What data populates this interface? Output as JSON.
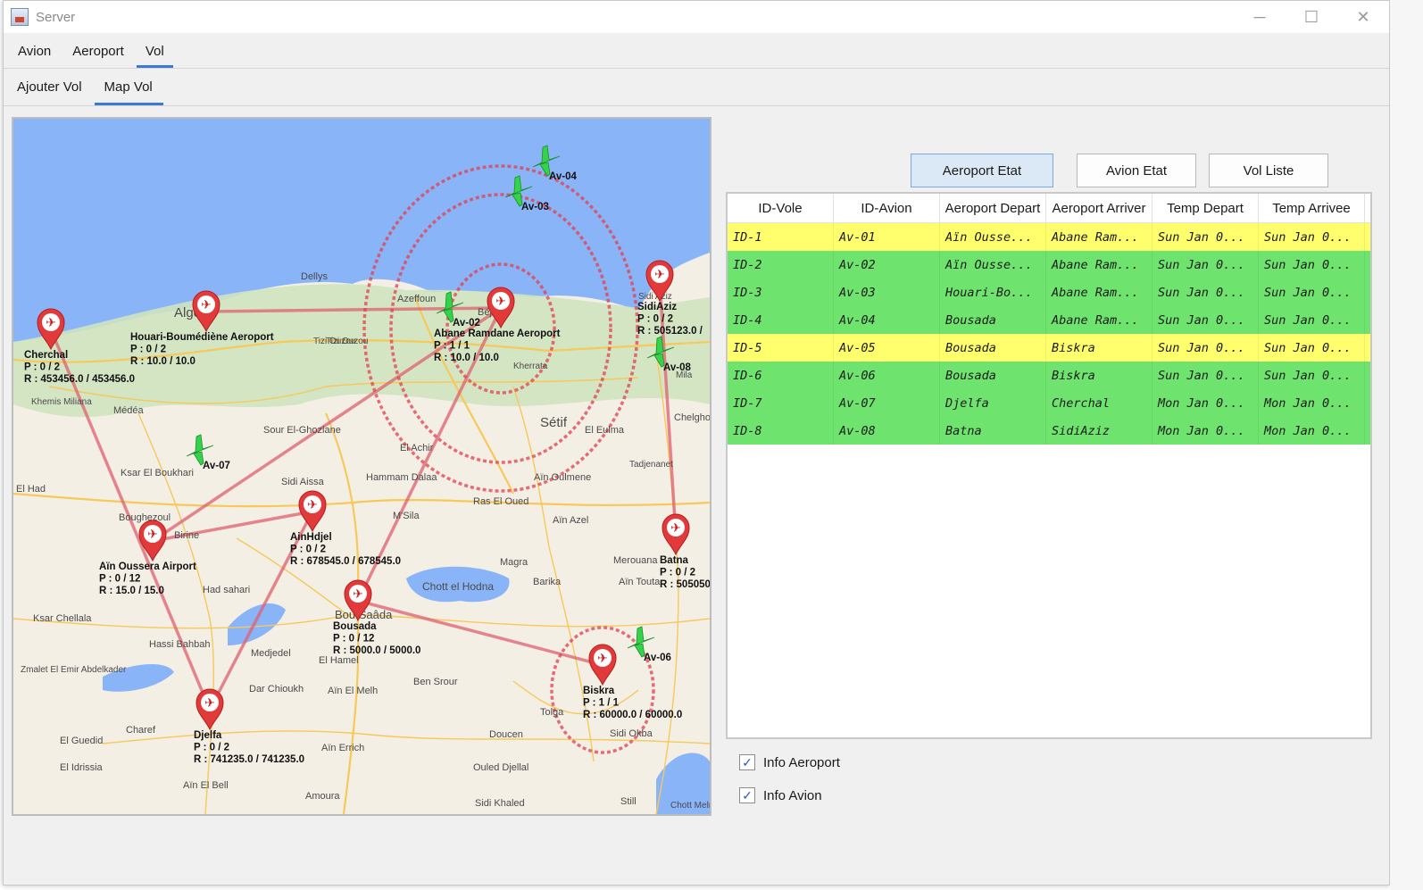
{
  "window": {
    "title": "Server",
    "controls": [
      "─",
      "☐",
      "✕"
    ]
  },
  "menu": [
    "Avion",
    "Aeroport",
    "Vol"
  ],
  "menu_active": 2,
  "subtabs": [
    "Ajouter Vol",
    "Map Vol"
  ],
  "subtab_active": 1,
  "buttons": {
    "aeroport_etat": "Aeroport Etat",
    "avion_etat": "Avion Etat",
    "vol_liste": "Vol Liste"
  },
  "table": {
    "columns": [
      "ID-Vole",
      "ID-Avion",
      "Aeroport Depart",
      "Aeroport Arriver",
      "Temp Depart",
      "Temp Arrivee"
    ],
    "rows": [
      {
        "color": "#ffff6e",
        "cells": [
          "ID-1",
          "Av-01",
          "Aïn Ousse...",
          "Abane Ram...",
          "Sun Jan 0...",
          "Sun Jan 0..."
        ]
      },
      {
        "color": "#6ee46e",
        "cells": [
          "ID-2",
          "Av-02",
          "Aïn Ousse...",
          "Abane Ram...",
          "Sun Jan 0...",
          "Sun Jan 0..."
        ]
      },
      {
        "color": "#6ee46e",
        "cells": [
          "ID-3",
          "Av-03",
          "Houari-Bo...",
          "Abane Ram...",
          "Sun Jan 0...",
          "Sun Jan 0..."
        ]
      },
      {
        "color": "#6ee46e",
        "cells": [
          "ID-4",
          "Av-04",
          "Bousada",
          "Abane Ram...",
          "Sun Jan 0...",
          "Sun Jan 0..."
        ]
      },
      {
        "color": "#ffff6e",
        "cells": [
          "ID-5",
          "Av-05",
          "Bousada",
          "Biskra",
          "Sun Jan 0...",
          "Sun Jan 0..."
        ]
      },
      {
        "color": "#6ee46e",
        "cells": [
          "ID-6",
          "Av-06",
          "Bousada",
          "Biskra",
          "Sun Jan 0...",
          "Sun Jan 0..."
        ]
      },
      {
        "color": "#6ee46e",
        "cells": [
          "ID-7",
          "Av-07",
          "Djelfa",
          "Cherchal",
          "Mon Jan 0...",
          "Mon Jan 0..."
        ]
      },
      {
        "color": "#6ee46e",
        "cells": [
          "ID-8",
          "Av-08",
          "Batna",
          "SidiAziz",
          "Mon Jan 0...",
          "Mon Jan 0..."
        ]
      }
    ]
  },
  "checkboxes": [
    {
      "label": "Info Aeroport",
      "checked": true
    },
    {
      "label": "Info Avion",
      "checked": true
    }
  ],
  "map": {
    "airports": [
      {
        "name": "Cherchal",
        "p": "P : 0 / 2",
        "r": "R : 453456.0 / 453456.0"
      },
      {
        "name": "Houari-Boumédiène Aeroport",
        "p": "P : 0 / 2",
        "r": "R : 10.0 / 10.0"
      },
      {
        "name": "Abane Ramdane Aeroport",
        "p": "P : 1 / 1",
        "r": "R : 10.0 / 10.0"
      },
      {
        "name": "SidiAziz",
        "p": "P : 0 / 2",
        "r": "R : 505123.0 /"
      },
      {
        "name": "Aïn Oussera Airport",
        "p": "P : 0 / 12",
        "r": "R : 15.0 / 15.0"
      },
      {
        "name": "AinHdjel",
        "p": "P : 0 / 2",
        "r": "R : 678545.0 / 678545.0"
      },
      {
        "name": "Batna",
        "p": "P : 0 / 2",
        "r": "R : 505050"
      },
      {
        "name": "Bousada",
        "p": "P : 0 / 12",
        "r": "R : 5000.0 / 5000.0"
      },
      {
        "name": "Biskra",
        "p": "P : 1 / 1",
        "r": "R : 60000.0 / 60000.0"
      },
      {
        "name": "Djelfa",
        "p": "P : 0 / 2",
        "r": "R : 741235.0 / 741235.0"
      }
    ],
    "planes": [
      "Av-04",
      "Av-03",
      "Av-02",
      "Av-08",
      "Av-07",
      "Av-06"
    ],
    "places": [
      "Alger",
      "Sétif",
      "Chott el Hodna",
      "Médéa",
      "Béjaïa",
      "Barika",
      "Tizi Ouzou",
      "Sour El-Ghozlane",
      "El Eulma",
      "Magra",
      "M'Sila",
      "Tolga",
      "Sidi Okba",
      "Bou Saâda",
      "Dellys",
      "Azeffoun",
      "Kherrata",
      "Mila",
      "Chelghoum Laid",
      "Tadjenanet",
      "Hammam Dalaa",
      "Sidi Aissa",
      "Ras El Oued",
      "Aïn Oulmene",
      "Ksar El Boukhari",
      "Boughezoul",
      "Birine",
      "Had sahari",
      "Hassi Bahbah",
      "Ksar Chellala",
      "Zmalet El Emir Abdelkader",
      "Medjedel",
      "El Hamel",
      "Dar Chioukh",
      "Aïn El Melh",
      "Ben Srour",
      "Aïn El Bell",
      "Charef",
      "El Guedid",
      "El Idrissia",
      "Amoura",
      "Aïn Errich",
      "Ouled Djellal",
      "Doucen",
      "Sidi Khaled",
      "Still",
      "Chott Melrhir",
      "Merouana",
      "Aïn Touta",
      "Aïn Azel",
      "El Had",
      "Khemis Miliana",
      "Tizi Ouzou",
      "El Achir",
      "Sidi Aziz"
    ]
  }
}
